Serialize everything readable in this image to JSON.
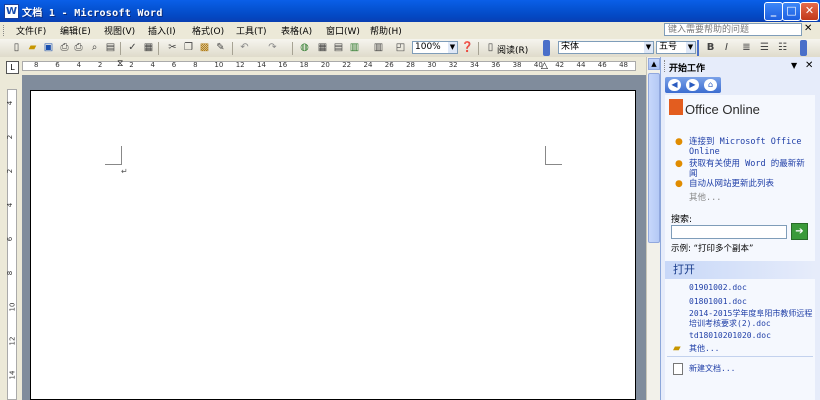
{
  "window": {
    "title": "文档 1 - Microsoft Word",
    "minimize": "_",
    "maximize": "□",
    "close": "✕"
  },
  "menu": {
    "items": [
      "文件(F)",
      "编辑(E)",
      "视图(V)",
      "插入(I)",
      "格式(O)",
      "工具(T)",
      "表格(A)",
      "窗口(W)",
      "帮助(H)"
    ],
    "help_placeholder": "键入需要帮助的问题",
    "help_close": "✕"
  },
  "toolbar": {
    "zoom": "100%",
    "read_label": "阅读(R)",
    "font": "宋体",
    "size": "五号",
    "bold": "B",
    "italic": "I"
  },
  "ruler": {
    "ticks": [
      "8",
      "6",
      "4",
      "2",
      "2",
      "4",
      "6",
      "8",
      "10",
      "12",
      "14",
      "16",
      "18",
      "20",
      "22",
      "24",
      "26",
      "28",
      "30",
      "32",
      "34",
      "36",
      "38",
      "40",
      "42",
      "44",
      "46",
      "48"
    ],
    "vticks": [
      "4",
      "2",
      "2",
      "4",
      "6",
      "8",
      "10",
      "12",
      "14"
    ]
  },
  "taskpane": {
    "title": "开始工作",
    "close": "✕",
    "office_online": "Office Online",
    "links": [
      "连接到 Microsoft Office Online",
      "获取有关使用 Word 的最新新闻",
      "自动从网站更新此列表"
    ],
    "more": "其他...",
    "search_label": "搜索:",
    "search_value": "",
    "example": "示例: “打印多个副本”",
    "open_title": "打开",
    "files": [
      "01901002.doc",
      "01801001.doc",
      "2014-2015学年度阜阳市教师远程培训考核要求(2).doc",
      "td18010201020.doc"
    ],
    "open_more": "其他...",
    "new_doc": "新建文档..."
  }
}
